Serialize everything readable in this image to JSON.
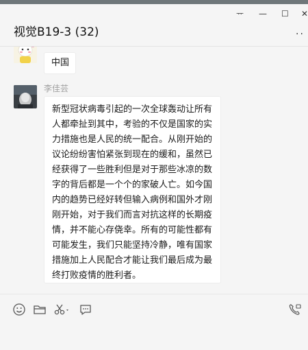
{
  "window": {
    "pin_label": "ᅲ",
    "minimize_label": "—",
    "maximize_label": "☐",
    "close_label": "✕",
    "title": "视觉B19-3 (32)",
    "more_label": "··"
  },
  "messages": [
    {
      "text": "中国"
    },
    {
      "sender": "李佳芸",
      "text": "新型冠状病毒引起的一次全球轰动让所有人都牵扯到其中，考验的不仅是国家的实力措施也是人民的统一配合。从刚开始的议论纷纷害怕紧张到现在的缓和，虽然已经获得了一些胜利但是对于那些冰凉的数字的背后都是一个个的家破人亡。如今国内的趋势已经好转但输入病例和国外才刚刚开始，对于我们而言对抗这样的长期疫情，并不能心存侥幸。所有的可能性都有可能发生，我们只能坚持冷静，唯有国家措施加上人民配合才能让我们最后成为最终打败疫情的胜利者。"
    }
  ],
  "toolbar": {
    "icons": [
      "emoji-icon",
      "folder-icon",
      "scissors-icon",
      "chat-bubble-icon",
      "video-call-icon"
    ]
  },
  "colors": {
    "background": "#f5f5f5",
    "bubble": "#ffffff",
    "sender": "#a0a0a0"
  }
}
